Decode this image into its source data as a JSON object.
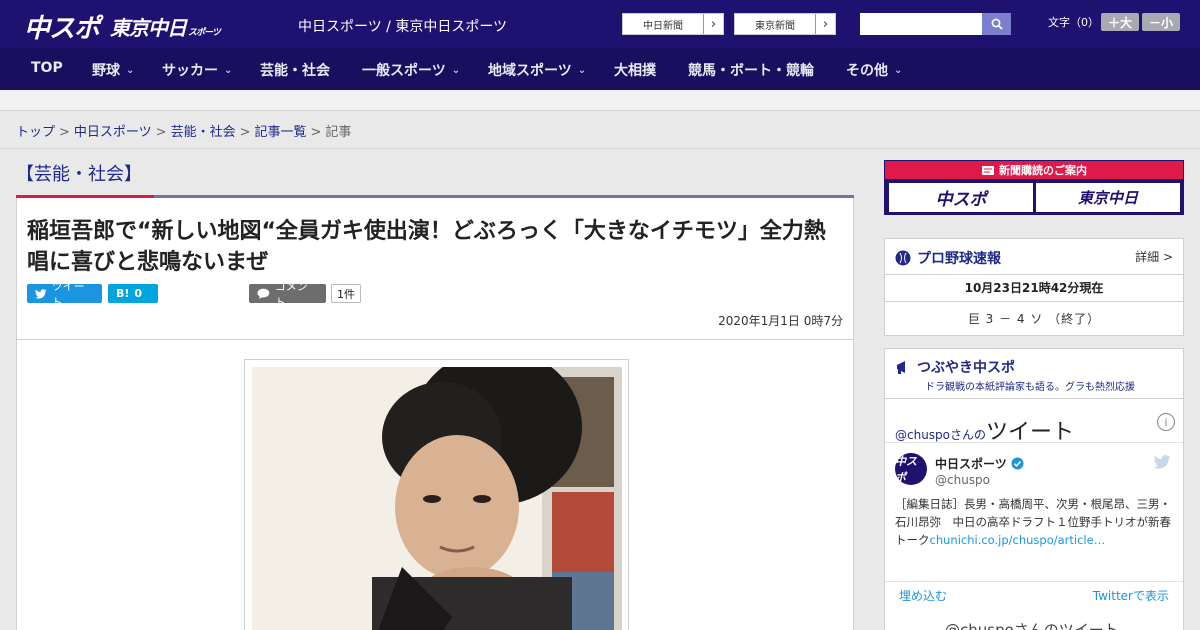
{
  "header": {
    "logo_chuspo": "中スポ",
    "logo_tokyo": "東京中日",
    "logo_tokyo_small": "スポーツ",
    "site_name": "中日スポーツ / 東京中日スポーツ",
    "ext_links": [
      {
        "label": "中日新聞"
      },
      {
        "label": "東京新聞"
      }
    ],
    "search_placeholder": "",
    "font_size_label": "文字（0）",
    "font_larger": "＋大",
    "font_smaller": "－小"
  },
  "nav": {
    "items": [
      {
        "label": "TOP",
        "dropdown": false
      },
      {
        "label": "野球",
        "dropdown": true
      },
      {
        "label": "サッカー",
        "dropdown": true
      },
      {
        "label": "芸能・社会",
        "dropdown": false
      },
      {
        "label": "一般スポーツ",
        "dropdown": true
      },
      {
        "label": "地域スポーツ",
        "dropdown": true
      },
      {
        "label": "大相撲",
        "dropdown": false
      },
      {
        "label": "競馬・ボート・競輪",
        "dropdown": false
      },
      {
        "label": "その他",
        "dropdown": true
      }
    ],
    "chevron": "⌄"
  },
  "breadcrumb": {
    "items": [
      "トップ",
      "中日スポーツ",
      "芸能・社会",
      "記事一覧"
    ],
    "current": "記事",
    "separator": ">"
  },
  "article": {
    "category": "【芸能・社会】",
    "headline": "稲垣吾郎で“新しい地図“全員ガキ使出演！どぶろっく「大きなイチモツ」全力熱唱に喜びと悲鳴ないまぜ",
    "tweet_label": "ツイート",
    "hatena_label": "B!",
    "hatena_count": "0",
    "comment_label": "コメント",
    "comment_count": "1件",
    "date": "2020年1月1日 0時7分"
  },
  "sidebar": {
    "subscribe": {
      "title": "新聞購読のご案内",
      "logo1": "中スポ",
      "logo2": "東京中日"
    },
    "baseball": {
      "title": "プロ野球速報",
      "detail": "詳細 >",
      "time": "10月23日21時42分現在",
      "score": "巨 3 － 4 ソ （終了）"
    },
    "tweets": {
      "title": "つぶやき中スポ",
      "subtitle": "ドラ観戦の本紙評論家も語る。グラも熱烈応援",
      "handle_prefix": "@chuspoさんの",
      "handle_suffix": "ツイート",
      "info": "i",
      "avatar": "中スポ",
      "account_name": "中日スポーツ",
      "account_user": "@chuspo",
      "text": "［編集日誌］長男・高橋周平、次男・根尾昂、三男・石川昂弥　中日の高卒ドラフト１位野手トリオが新春トーク",
      "link": "chunichi.co.jp/chuspo/article…",
      "embed": "埋め込む",
      "view_on_twitter": "Twitterで表示",
      "footer": "@chuspoさんのツイート"
    }
  },
  "colors": {
    "brand_navy": "#1f1170",
    "nav_navy": "#1a0f5e",
    "accent_red": "#e0194b",
    "link_blue": "#1f2a8c",
    "twitter_blue": "#1b95e0"
  }
}
